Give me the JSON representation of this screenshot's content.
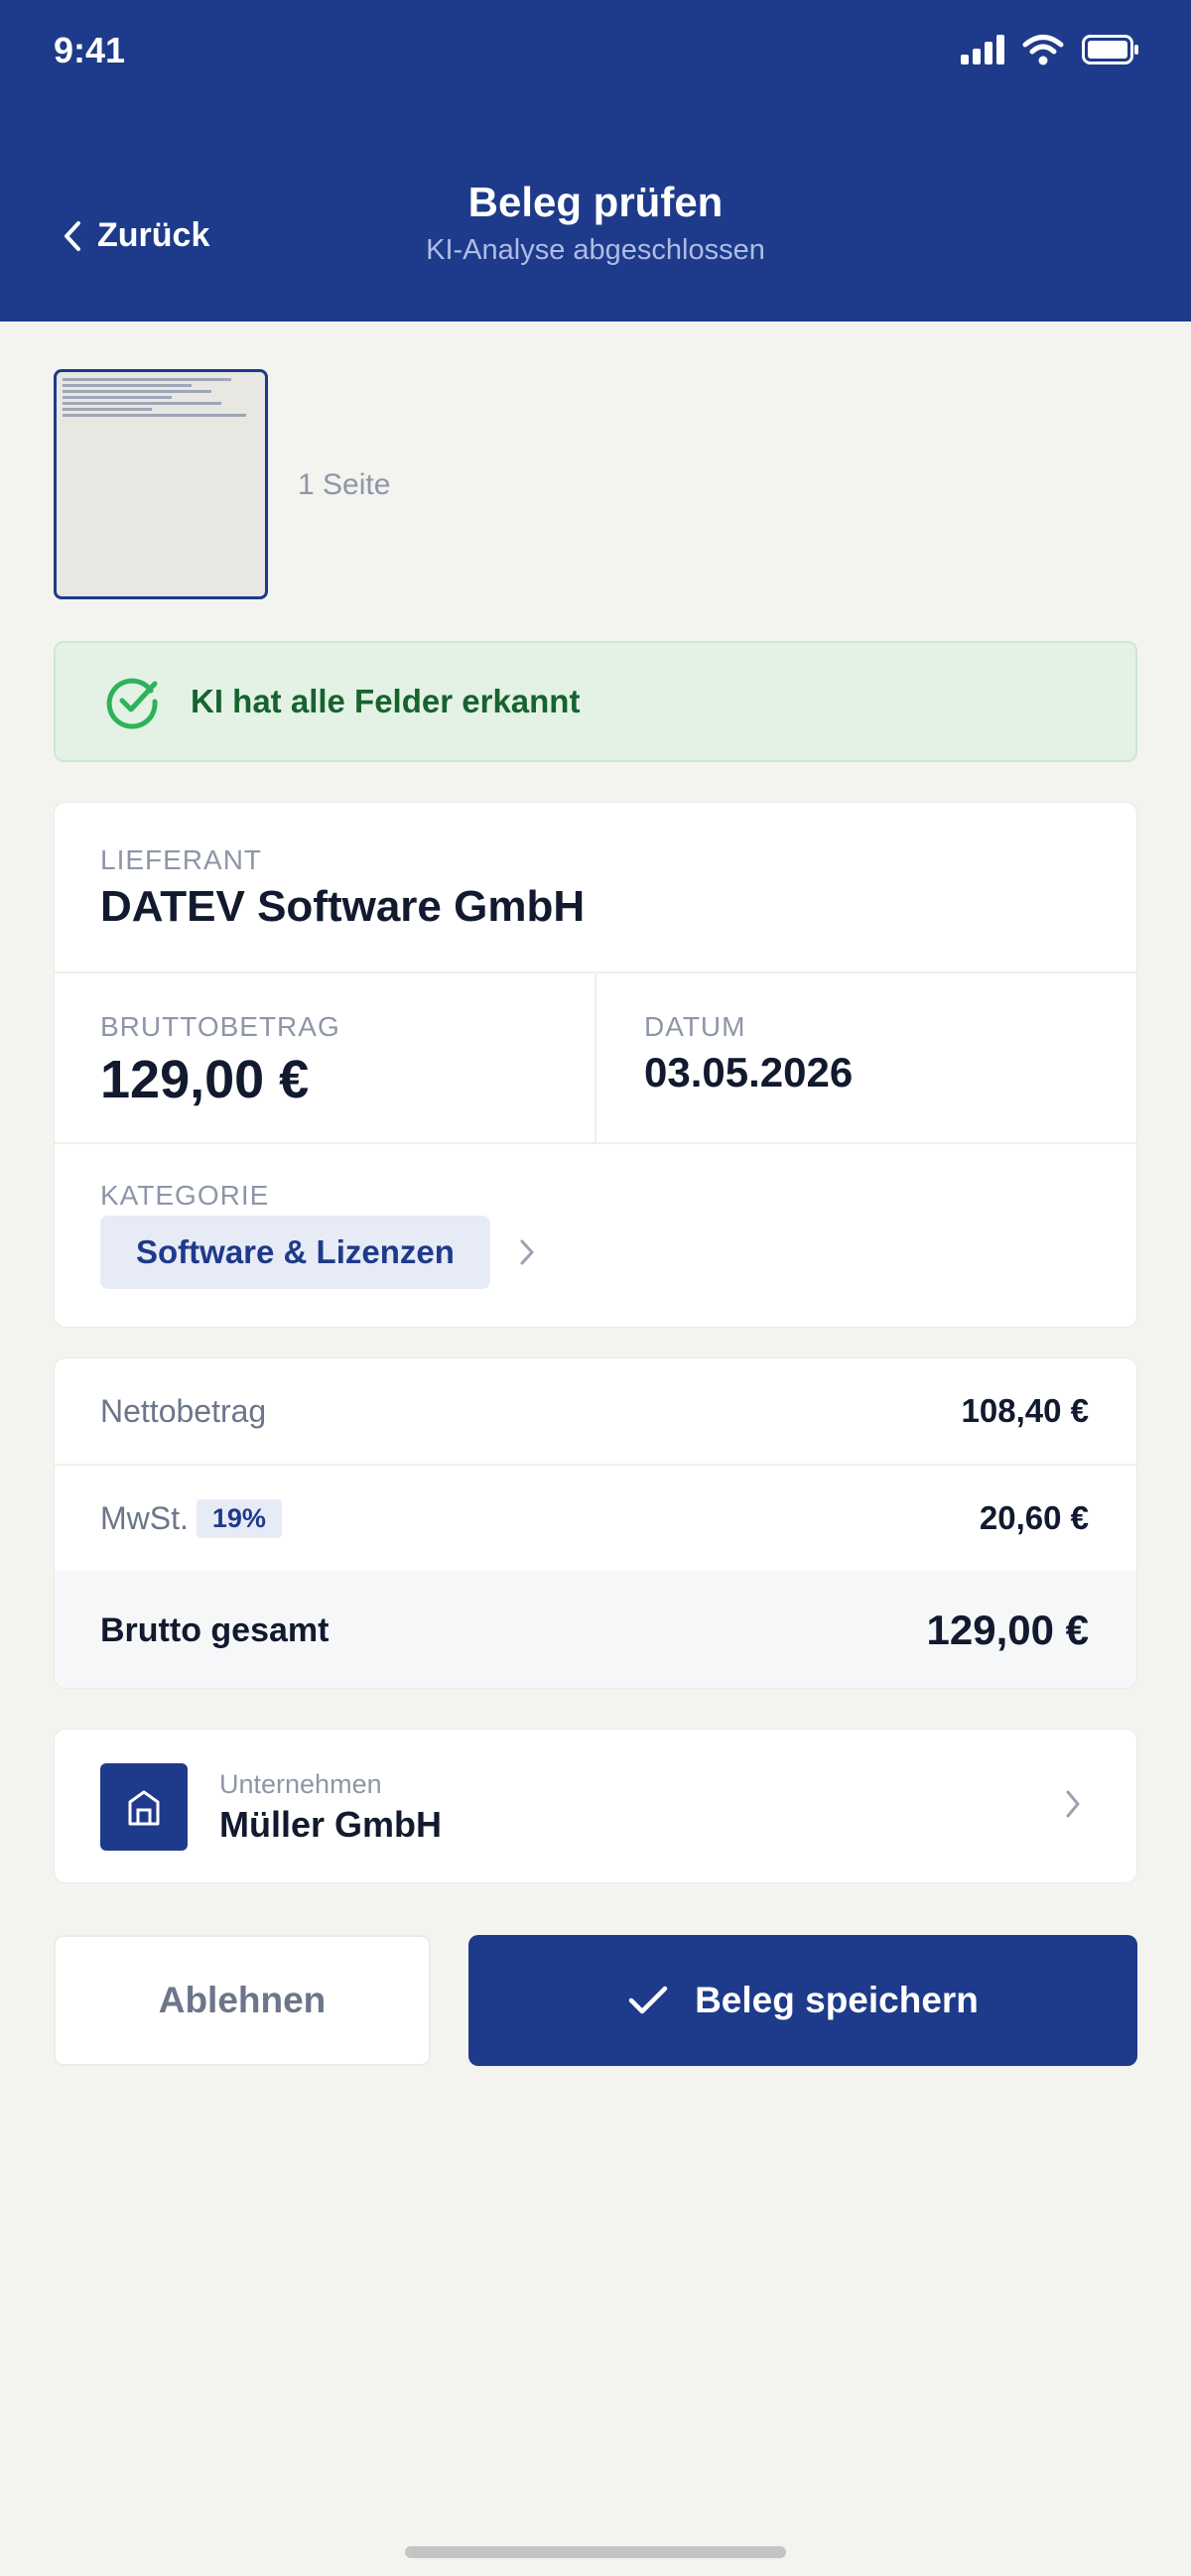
{
  "status_bar": {
    "time": "9:41"
  },
  "header": {
    "back_label": "Zurück",
    "title": "Beleg prüfen",
    "subtitle": "KI-Analyse abgeschlossen"
  },
  "document": {
    "pages_label": "1 Seite"
  },
  "banner": {
    "text": "KI hat alle Felder erkannt"
  },
  "fields": {
    "vendor_label": "LIEFERANT",
    "vendor_value": "DATEV Software GmbH",
    "gross_label": "BRUTTOBETRAG",
    "gross_value": "129,00 €",
    "date_label": "DATUM",
    "date_value": "03.05.2026",
    "category_label": "KATEGORIE",
    "category_value": "Software & Lizenzen"
  },
  "summary": {
    "net_label": "Nettobetrag",
    "net_value": "108,40 €",
    "vat_label": "MwSt.",
    "vat_rate": "19%",
    "vat_value": "20,60 €",
    "total_label": "Brutto gesamt",
    "total_value": "129,00 €"
  },
  "company": {
    "label": "Unternehmen",
    "name": "Müller GmbH"
  },
  "actions": {
    "reject_label": "Ablehnen",
    "save_label": "Beleg speichern"
  },
  "colors": {
    "primary": "#1e3a8a",
    "success": "#17632f",
    "success_bg": "#e3f2e5",
    "background": "#f3f3ef"
  },
  "icons": {
    "back": "chevron-left-icon",
    "check_circle": "check-circle-icon",
    "category_chevron": "chevron-right-icon",
    "company": "building-icon",
    "save": "checkmark-icon"
  }
}
